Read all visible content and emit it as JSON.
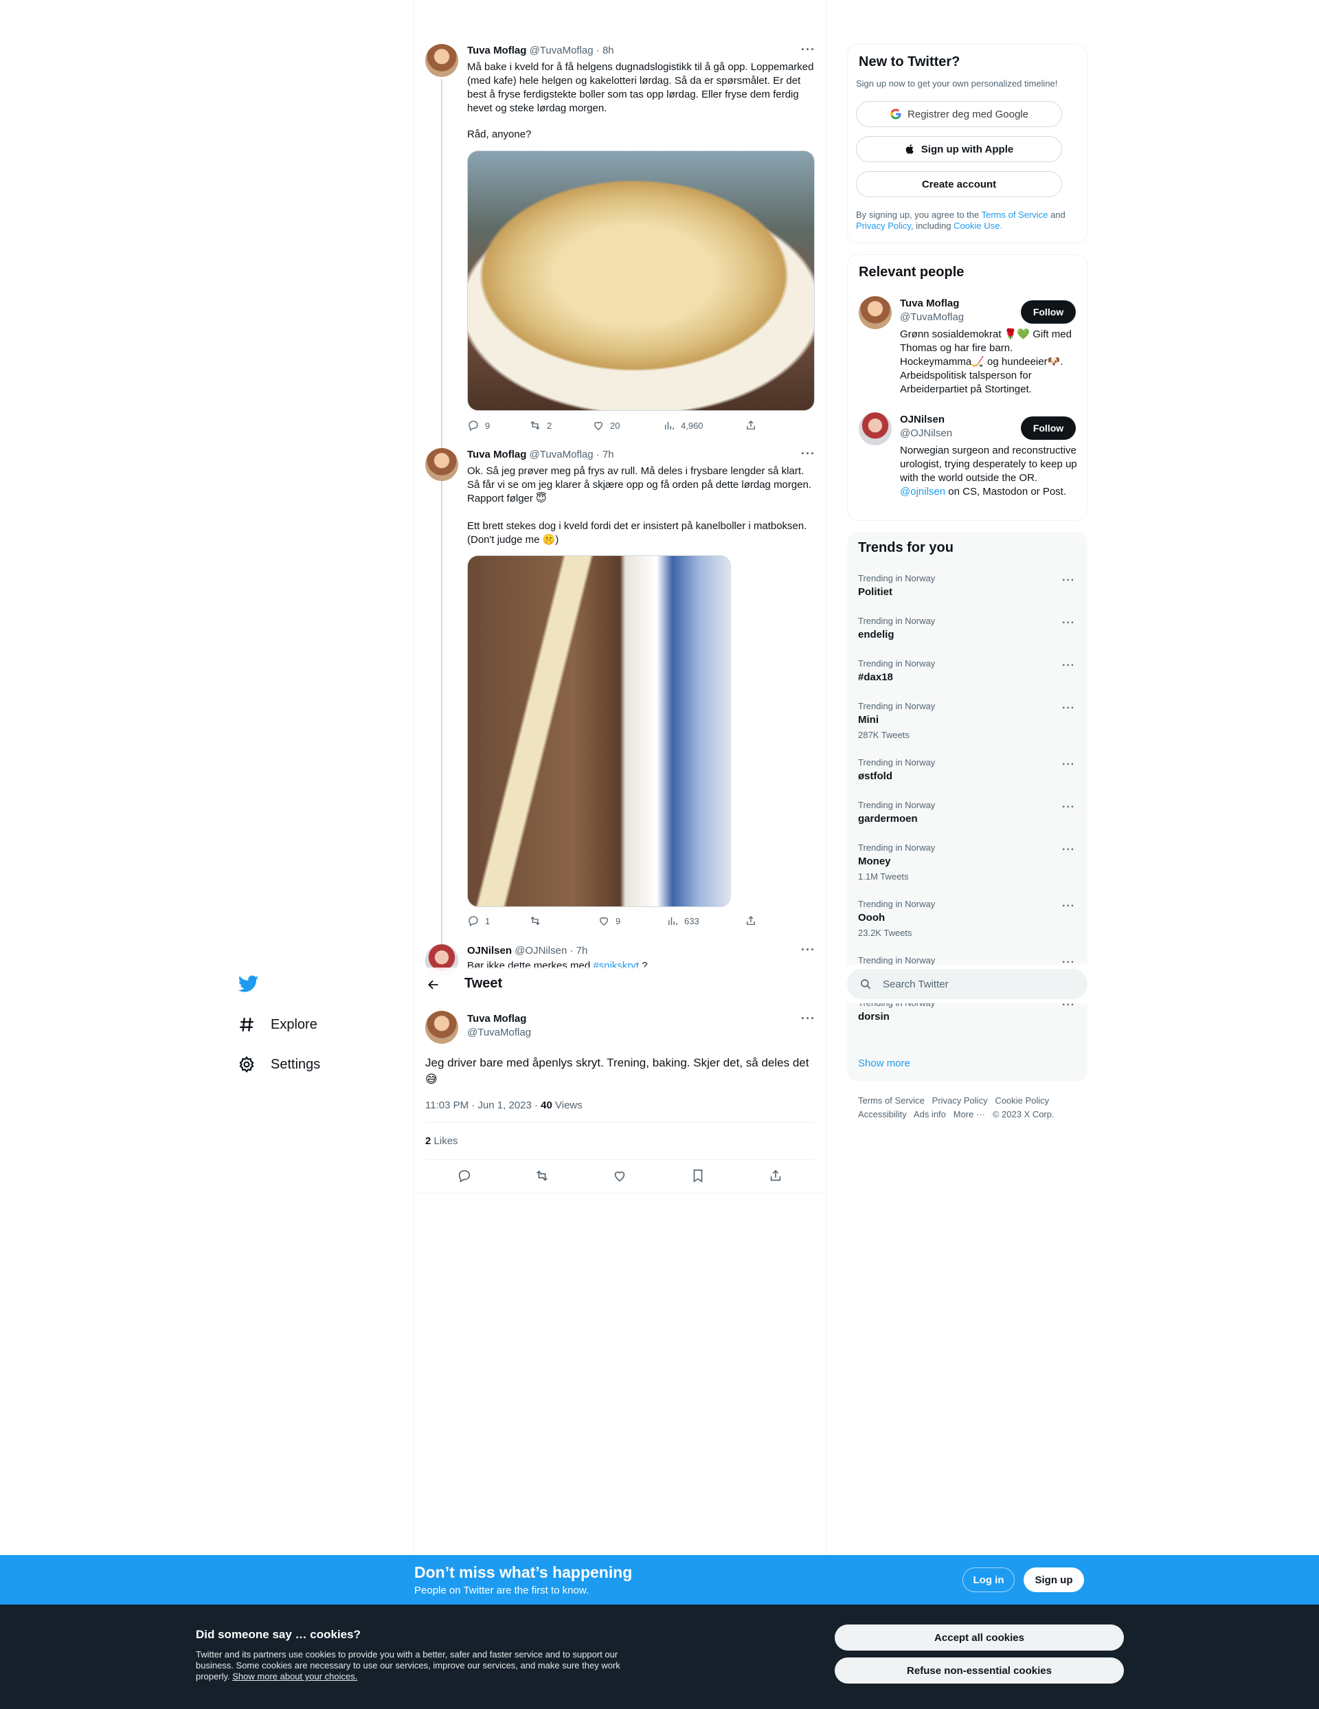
{
  "thread": [
    {
      "name": "Tuva Moflag",
      "handle": "@TuvaMoflag",
      "time": "· 8h",
      "text": "Må bake i kveld for å få helgens dugnadslogistikk til å gå opp. Loppemarked (med kafe) hele helgen og kakelotteri lørdag. Så da er spørsmålet. Er det best å fryse ferdigstekte boller som tas opp lørdag. Eller fryse dem ferdig hevet og steke lørdag morgen.",
      "text2": "Råd, anyone?",
      "replies": "9",
      "retweets": "2",
      "likes": "20",
      "views": "4,960"
    },
    {
      "name": "Tuva Moflag",
      "handle": "@TuvaMoflag",
      "time": "· 7h",
      "text": "Ok. Så jeg prøver meg på frys av rull. Må deles i frysbare lengder så klart. Så får vi se om jeg klarer å skjære opp og få orden på dette lørdag morgen. Rapport følger 😇",
      "text2": "Ett brett stekes dog i kveld fordi det er insistert på kanelboller i matboksen. (Don't judge me 🤫)",
      "replies": "1",
      "retweets": "",
      "likes": "9",
      "views": "633"
    },
    {
      "name": "OJNilsen",
      "handle": "@OJNilsen",
      "time": "· 7h",
      "text_prefix": "Bør ikke dette merkes med",
      "hashtag": "#snikskryt",
      "text_suffix": "?"
    }
  ],
  "header": {
    "title": "Tweet"
  },
  "main_tweet": {
    "name": "Tuva Moflag",
    "handle": "@TuvaMoflag",
    "text": "Jeg driver bare med åpenlys skryt. Trening, baking. Skjer det, så deles det 😅",
    "timestamp": "11:03 PM · Jun 1, 2023 ·",
    "views_count": "40",
    "views_label": "Views",
    "likes_count": "2",
    "likes_label": "Likes"
  },
  "nav": {
    "items": [
      {
        "label": "Explore",
        "icon": "hashtag-icon"
      },
      {
        "label": "Settings",
        "icon": "gear-icon"
      }
    ]
  },
  "signup_card": {
    "title": "New to Twitter?",
    "subtitle": "Sign up now to get your own personalized timeline!",
    "google_label": "Registrer deg med Google",
    "apple_label": "Sign up with Apple",
    "create_label": "Create account",
    "legal_prefix": "By signing up, you agree to the",
    "terms": "Terms of Service",
    "and": "and",
    "privacy": "Privacy Policy",
    "including": ", including",
    "cookie_use": "Cookie Use."
  },
  "relevant_people": {
    "title": "Relevant people",
    "follow_label": "Follow",
    "people": [
      {
        "name": "Tuva Moflag",
        "handle": "@TuvaMoflag",
        "bio": "Grønn sosialdemokrat 🌹💚 Gift med Thomas og har fire barn. Hockeymamma🏒 og hundeeier🐶. Arbeidspolitisk talsperson for Arbeiderpartiet på Stortinget."
      },
      {
        "name": "OJNilsen",
        "handle": "@OJNilsen",
        "bio_prefix": "Norwegian surgeon and reconstructive urologist, trying desperately to keep up with the world outside the OR.",
        "bio_link": "@ojnilsen",
        "bio_suffix": "on CS, Mastodon or Post."
      }
    ]
  },
  "trends": {
    "title": "Trends for you",
    "items": [
      {
        "category": "Trending in Norway",
        "name": "Politiet",
        "count": ""
      },
      {
        "category": "Trending in Norway",
        "name": "endelig",
        "count": ""
      },
      {
        "category": "Trending in Norway",
        "name": "#dax18",
        "count": ""
      },
      {
        "category": "Trending in Norway",
        "name": "Mini",
        "count": "287K Tweets"
      },
      {
        "category": "Trending in Norway",
        "name": "østfold",
        "count": ""
      },
      {
        "category": "Trending in Norway",
        "name": "gardermoen",
        "count": ""
      },
      {
        "category": "Trending in Norway",
        "name": "Money",
        "count": "1.1M Tweets"
      },
      {
        "category": "Trending in Norway",
        "name": "Oooh",
        "count": "23.2K Tweets"
      },
      {
        "category": "Trending in Norway",
        "name": "",
        "count": ""
      },
      {
        "category": "Trending in Norway",
        "name": "dorsin",
        "count": ""
      }
    ],
    "show_more": "Show more"
  },
  "search": {
    "placeholder": "Search Twitter"
  },
  "footer": {
    "links": [
      "Terms of Service",
      "Privacy Policy",
      "Cookie Policy",
      "Accessibility",
      "Ads info",
      "More ···",
      "© 2023 X Corp."
    ]
  },
  "signup_bar": {
    "title": "Don’t miss what’s happening",
    "subtitle": "People on Twitter are the first to know.",
    "login": "Log in",
    "signup": "Sign up"
  },
  "cookies": {
    "title": "Did someone say … cookies?",
    "body": "Twitter and its partners use cookies to provide you with a better, safer and faster service and to support our business. Some cookies are necessary to use our services, improve our services, and make sure they work properly.",
    "link": "Show more about your choices.",
    "accept": "Accept all cookies",
    "refuse": "Refuse non-essential cookies"
  },
  "colors": {
    "accent": "#1d9bf0",
    "text": "#0f1419",
    "muted": "#536471",
    "cookie_bg": "#15202b"
  }
}
